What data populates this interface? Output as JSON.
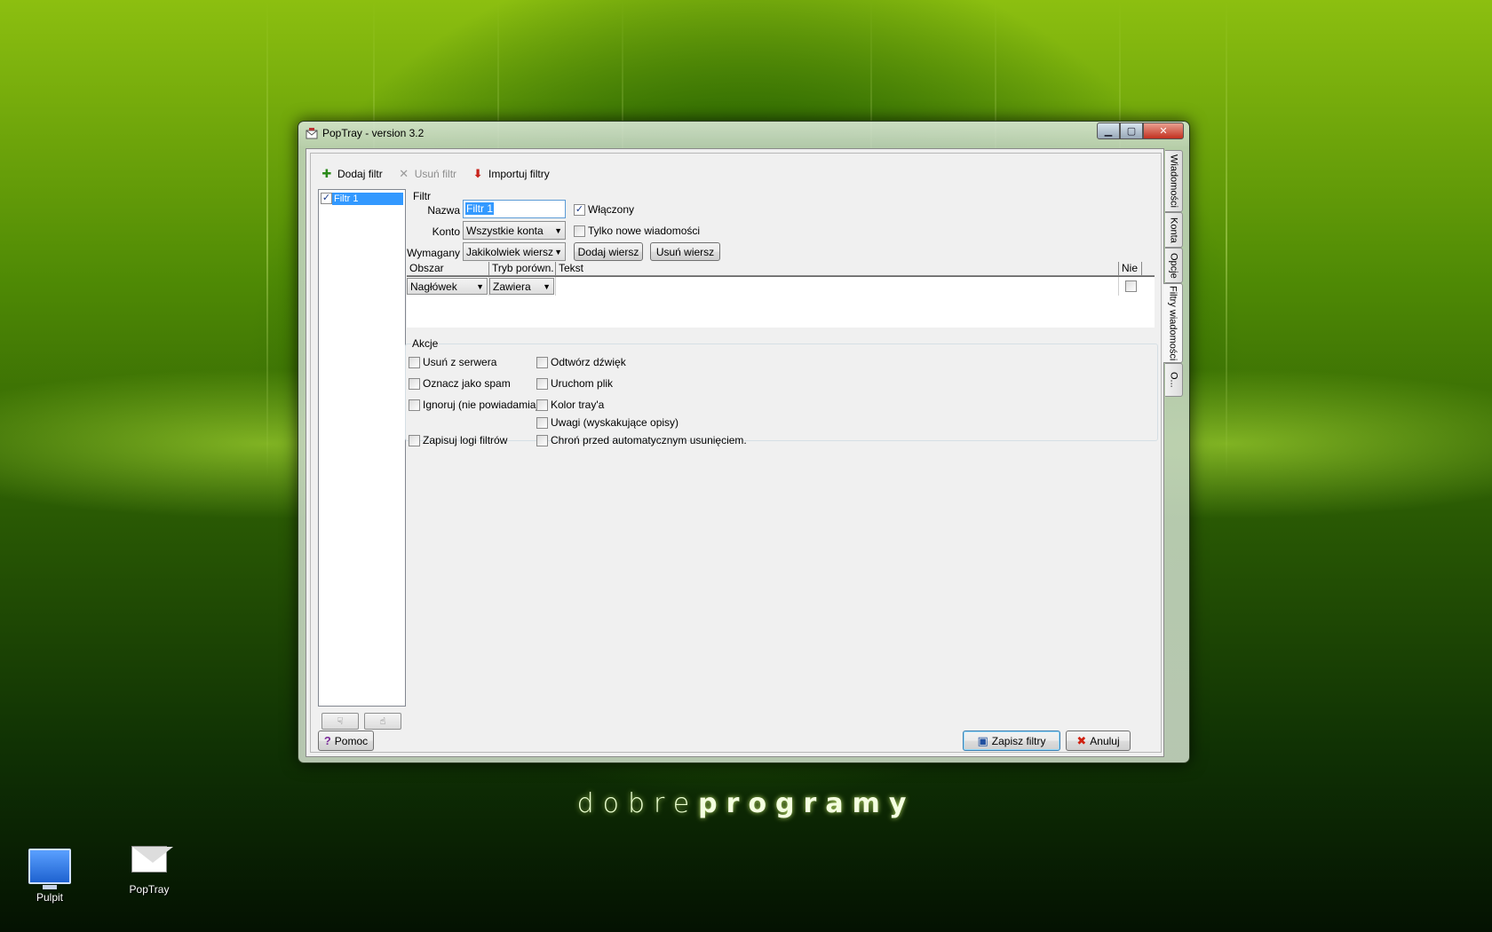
{
  "window": {
    "title": "PopTray - version 3.2"
  },
  "side_tabs": [
    "Wiadomości",
    "Konta",
    "Opcje",
    "Filtry wiadomości",
    "O..."
  ],
  "toolbar": {
    "add_label": "Dodaj filtr",
    "remove_label": "Usuń filtr",
    "import_label": "Importuj filtry"
  },
  "filter_list": {
    "items": [
      {
        "label": "Filtr 1",
        "checked": true,
        "selected": true
      }
    ]
  },
  "filter_group": {
    "title": "Filtr",
    "name_label": "Nazwa",
    "name_value": "Filtr 1",
    "enabled_label": "Włączony",
    "enabled_checked": true,
    "account_label": "Konto",
    "account_value": "Wszystkie konta",
    "only_new_label": "Tylko nowe wiadomości",
    "only_new_checked": false,
    "required_label": "Wymagany",
    "required_value": "Jakikolwiek wiersz",
    "add_row_label": "Dodaj wiersz",
    "remove_row_label": "Usuń wiersz"
  },
  "grid": {
    "columns": [
      "Obszar",
      "Tryb porówn.",
      "Tekst",
      "Nie"
    ],
    "rows": [
      {
        "area": "Nagłówek",
        "mode": "Zawiera",
        "text": "",
        "not": false
      }
    ]
  },
  "actions": {
    "title": "Akcje",
    "left": [
      {
        "label": "Usuń z serwera",
        "checked": false
      },
      {
        "label": "Oznacz jako spam",
        "checked": false
      },
      {
        "label": "Ignoruj (nie powiadamiaj)",
        "checked": false
      },
      {
        "label": "Zapisuj logi filtrów",
        "checked": false
      }
    ],
    "right": [
      {
        "label": "Odtwórz dźwięk",
        "checked": false
      },
      {
        "label": "Uruchom plik",
        "checked": false
      },
      {
        "label": "Kolor tray'a",
        "checked": false
      },
      {
        "label": "Uwagi (wyskakujące opisy)",
        "checked": false
      },
      {
        "label": "Chroń przed automatycznym usunięciem.",
        "checked": false
      }
    ]
  },
  "footer": {
    "help_label": "Pomoc",
    "save_label": "Zapisz filtry",
    "cancel_label": "Anuluj"
  },
  "desktop": {
    "icons": [
      {
        "label": "Pulpit",
        "icon": "monitor-icon"
      },
      {
        "label": "PopTray",
        "icon": "mail-icon"
      }
    ],
    "wallpaper_brand_a": "dobre",
    "wallpaper_brand_b": "programy"
  },
  "colors": {
    "selection": "#3399ff",
    "wallpaper_green": "#4f8a05"
  }
}
